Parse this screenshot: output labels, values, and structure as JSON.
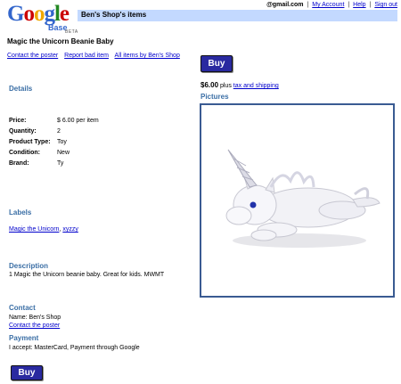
{
  "header": {
    "logo_word": "Google",
    "logo_sub": "Base",
    "logo_beta": "BETA",
    "email": "@gmail.com",
    "nav": [
      "My Account",
      "Help",
      "Sign out"
    ],
    "title": "Ben's Shop's items"
  },
  "item": {
    "title": "Magic the Unicorn Beanie Baby",
    "links": [
      "Contact the poster",
      "Report bad item",
      "All items by Ben's Shop"
    ],
    "buy_label": "Buy",
    "price": "$6.00",
    "price_plus": "plus",
    "shipping_link": "tax and shipping"
  },
  "pictures": {
    "heading": "Pictures"
  },
  "details": {
    "heading": "Details",
    "rows": [
      {
        "label": "Price:",
        "value": "$ 6.00 per item"
      },
      {
        "label": "Quantity:",
        "value": "2"
      },
      {
        "label": "Product Type:",
        "value": "Toy"
      },
      {
        "label": "Condition:",
        "value": "New"
      },
      {
        "label": "Brand:",
        "value": "Ty"
      }
    ]
  },
  "labels": {
    "heading": "Labels",
    "items": [
      "Magic the Unicorn",
      "xyzzy"
    ],
    "separator": ", "
  },
  "description": {
    "heading": "Description",
    "text": "1 Magic the Unicorn beanie baby. Great for kids. MWMT"
  },
  "contact": {
    "heading": "Contact",
    "name": "Name: Ben's Shop",
    "link": "Contact the poster"
  },
  "payment": {
    "heading": "Payment",
    "text": "I accept: MasterCard, Payment through Google"
  },
  "colors": {
    "title_bar": "#c3d9ff",
    "section_heading": "#3a6ea5",
    "buy_button": "#2a2aa0",
    "link": "#0000cc"
  }
}
